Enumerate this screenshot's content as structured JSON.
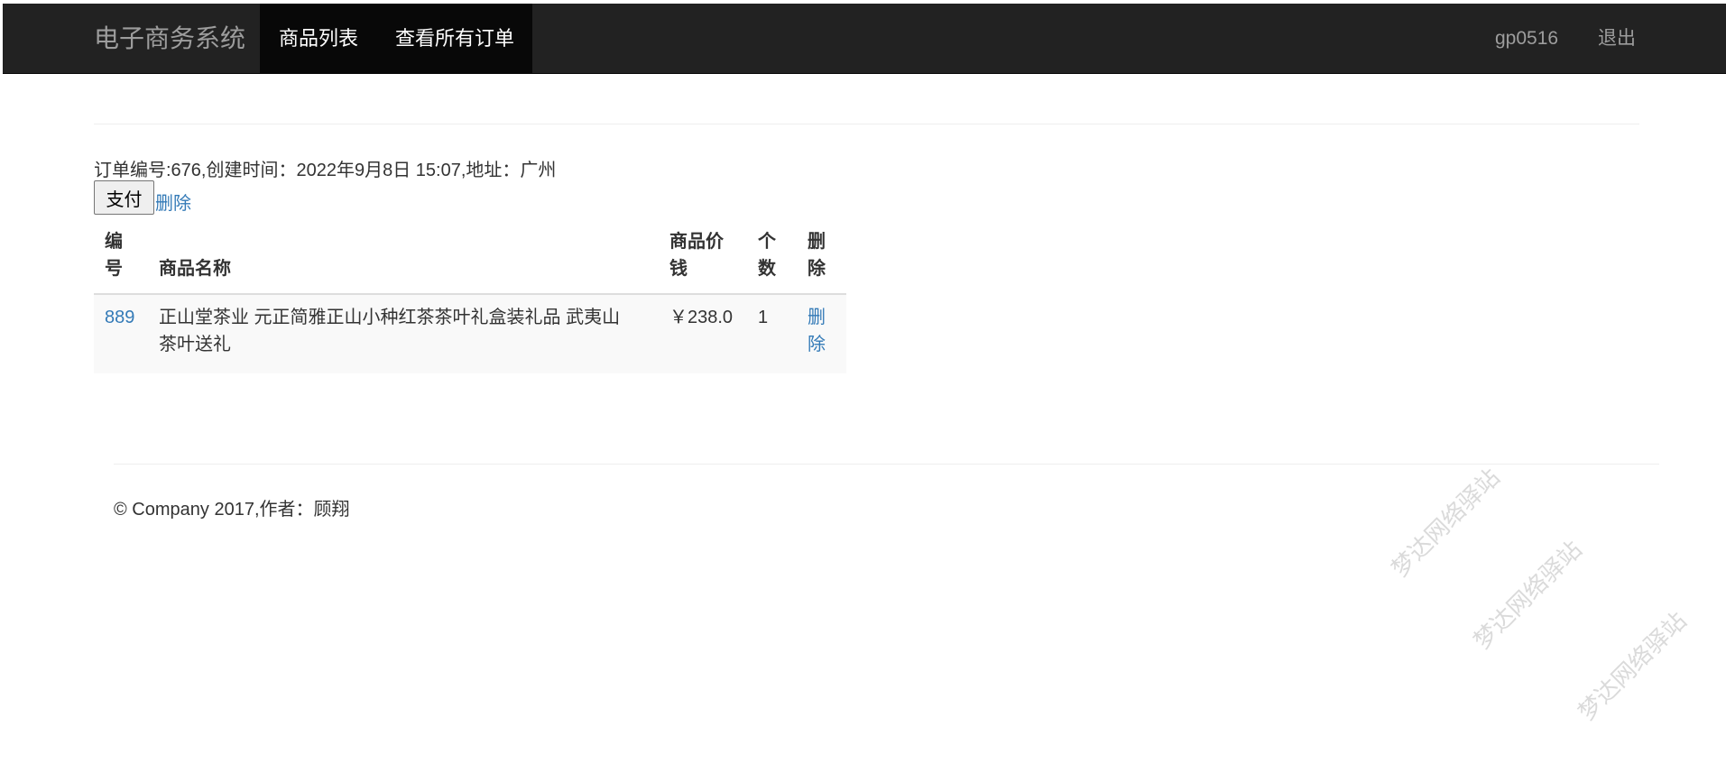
{
  "navbar": {
    "brand": "电子商务系统",
    "tabs": [
      {
        "label": "商品列表"
      },
      {
        "label": "查看所有订单"
      }
    ],
    "user": "gp0516",
    "logout": "退出"
  },
  "order": {
    "info": "订单编号:676,创建时间：2022年9月8日 15:07,地址：广州",
    "pay_label": "支付",
    "delete_label": "删除"
  },
  "table": {
    "headers": {
      "id": [
        "编",
        "号"
      ],
      "name": "商品名称",
      "price": [
        "商品价",
        "钱"
      ],
      "count": [
        "个",
        "数"
      ],
      "delete": [
        "删",
        "除"
      ]
    },
    "rows": [
      {
        "id": "889",
        "name_lines": [
          "正山堂茶业 元正简雅正山小种红茶茶叶礼盒装礼品 武夷山",
          "茶叶送礼"
        ],
        "price": "￥238.0",
        "count": "1",
        "delete_lines": [
          "删",
          "除"
        ]
      }
    ]
  },
  "footer": {
    "text": "© Company 2017,作者：顾翔"
  },
  "watermark": "梦达网络驿站"
}
